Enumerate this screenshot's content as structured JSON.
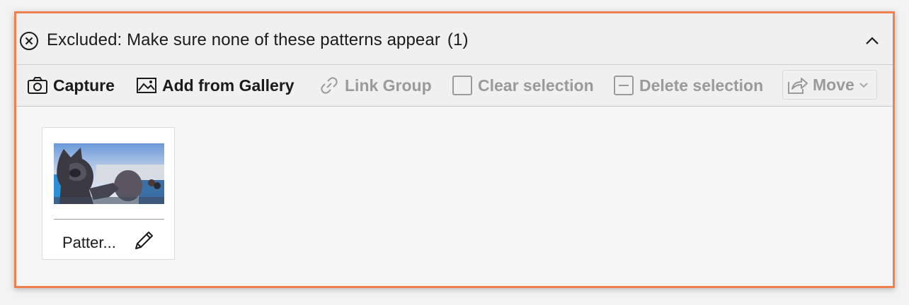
{
  "header": {
    "title": "Excluded: Make sure none of these patterns appear",
    "count": "(1)",
    "close_icon": "circle-x-icon",
    "collapse_icon": "chevron-up-icon"
  },
  "toolbar": {
    "capture_label": "Capture",
    "add_gallery_label": "Add from Gallery",
    "link_group_label": "Link Group",
    "clear_selection_label": "Clear selection",
    "delete_selection_label": "Delete selection",
    "move_label": "Move"
  },
  "patterns": [
    {
      "name": "Patter...",
      "image": "mascot-photo"
    }
  ],
  "colors": {
    "border_accent": "#f0804e",
    "enabled_text": "#1b1b1b",
    "disabled_text": "#9a9a9a"
  }
}
